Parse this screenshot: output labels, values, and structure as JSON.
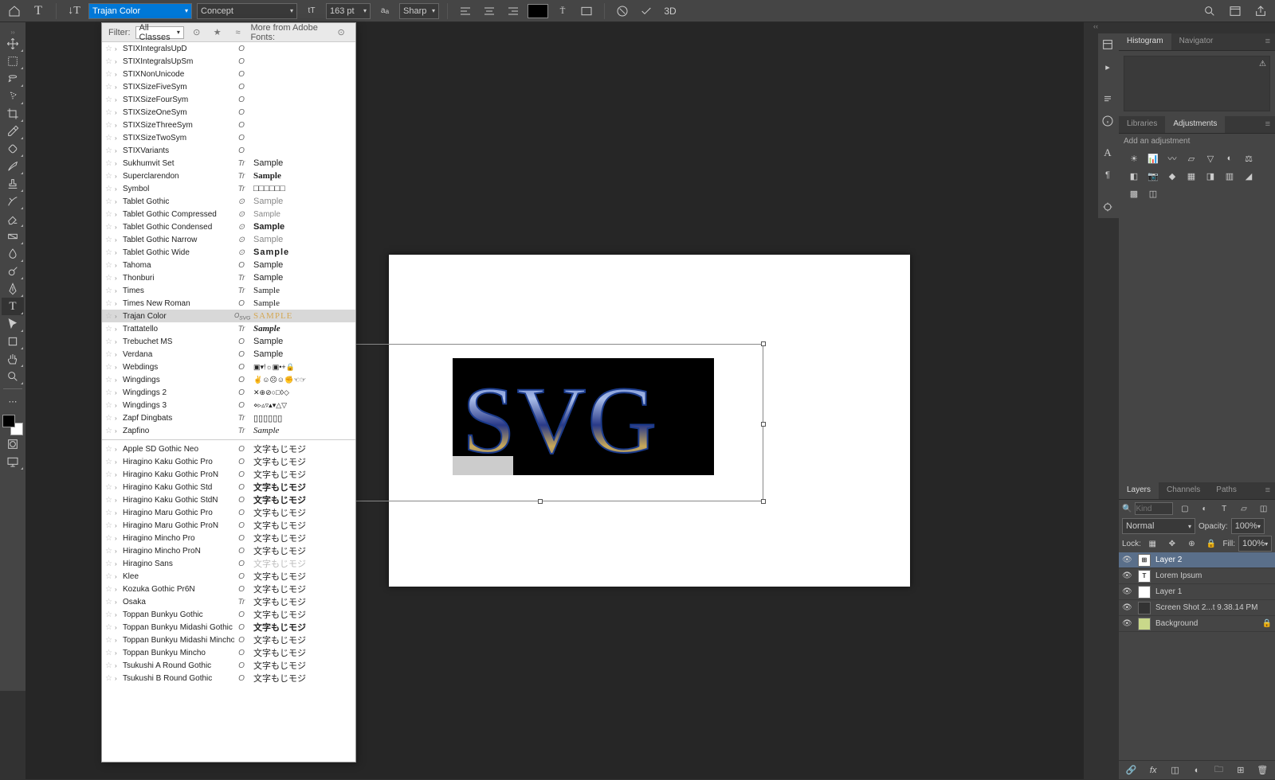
{
  "topbar": {
    "font_family_input": "Trajan Color",
    "font_style": "Concept",
    "font_size": "163 pt",
    "anti_alias": "Sharp",
    "color_swatch": "#000000"
  },
  "font_panel": {
    "filter_label": "Filter:",
    "filter_value": "All Classes",
    "more_fonts_label": "More from Adobe Fonts:",
    "selected": "Trajan Color",
    "groups": [
      [
        {
          "name": "STIXIntegralsUpD",
          "type": "O",
          "sample": ""
        },
        {
          "name": "STIXIntegralsUpSm",
          "type": "O",
          "sample": ""
        },
        {
          "name": "STIXNonUnicode",
          "type": "O",
          "sample": ""
        },
        {
          "name": "STIXSizeFiveSym",
          "type": "O",
          "sample": ""
        },
        {
          "name": "STIXSizeFourSym",
          "type": "O",
          "sample": ""
        },
        {
          "name": "STIXSizeOneSym",
          "type": "O",
          "sample": ""
        },
        {
          "name": "STIXSizeThreeSym",
          "type": "O",
          "sample": ""
        },
        {
          "name": "STIXSizeTwoSym",
          "type": "O",
          "sample": ""
        },
        {
          "name": "STIXVariants",
          "type": "O",
          "sample": ""
        },
        {
          "name": "Sukhumvit Set",
          "type": "Tr",
          "sample": "Sample",
          "sfont": "sans-serif",
          "sstyle": ""
        },
        {
          "name": "Superclarendon",
          "type": "Tr",
          "sample": "Sample",
          "sfont": "Georgia,serif",
          "sstyle": "font-weight:bold;"
        },
        {
          "name": "Symbol",
          "type": "Tr",
          "sample": "□□□□□□",
          "sfont": "serif"
        },
        {
          "name": "Tablet Gothic",
          "type": "⊙",
          "sample": "Sample",
          "sfont": "sans-serif",
          "sstyle": "color:#888;"
        },
        {
          "name": "Tablet Gothic Compressed",
          "type": "⊙",
          "sample": "Sample",
          "sfont": "'Arial Narrow',sans-serif",
          "sstyle": "font-size:10px;color:#888;"
        },
        {
          "name": "Tablet Gothic Condensed",
          "type": "⊙",
          "sample": "Sample",
          "sfont": "sans-serif",
          "sstyle": "font-weight:bold;"
        },
        {
          "name": "Tablet Gothic Narrow",
          "type": "⊙",
          "sample": "Sample",
          "sfont": "'Arial Narrow',sans-serif",
          "sstyle": "color:#888;"
        },
        {
          "name": "Tablet Gothic Wide",
          "type": "⊙",
          "sample": "Sample",
          "sfont": "sans-serif",
          "sstyle": "font-weight:900;letter-spacing:1px;"
        },
        {
          "name": "Tahoma",
          "type": "O",
          "sample": "Sample",
          "sfont": "Tahoma,sans-serif"
        },
        {
          "name": "Thonburi",
          "type": "Tr",
          "sample": "Sample",
          "sfont": "sans-serif"
        },
        {
          "name": "Times",
          "type": "Tr",
          "sample": "Sample",
          "sfont": "Times,serif"
        },
        {
          "name": "Times New Roman",
          "type": "O",
          "sample": "Sample",
          "sfont": "'Times New Roman',serif"
        },
        {
          "name": "Trajan Color",
          "type": "O_svg",
          "sample": "SAMPLE",
          "sfont": "'Trajan Pro','Times New Roman',serif",
          "sstyle": "color:#d4a855;letter-spacing:1px;"
        },
        {
          "name": "Trattatello",
          "type": "Tr",
          "sample": "Sample",
          "sfont": "cursive",
          "sstyle": "font-style:italic;font-weight:bold;"
        },
        {
          "name": "Trebuchet MS",
          "type": "O",
          "sample": "Sample",
          "sfont": "'Trebuchet MS',sans-serif"
        },
        {
          "name": "Verdana",
          "type": "O",
          "sample": "Sample",
          "sfont": "Verdana,sans-serif"
        },
        {
          "name": "Webdings",
          "type": "O",
          "sample": "▣▾!☼▣•+🔒",
          "sfont": "sans-serif",
          "sstyle": "font-size:9px;"
        },
        {
          "name": "Wingdings",
          "type": "O",
          "sample": "✌☺☹☺✊☜☞",
          "sfont": "sans-serif",
          "sstyle": "font-size:9px;"
        },
        {
          "name": "Wingdings 2",
          "type": "O",
          "sample": "✕⊕⊘○□◊◇",
          "sfont": "sans-serif",
          "sstyle": "font-size:9px;"
        },
        {
          "name": "Wingdings 3",
          "type": "O",
          "sample": "⋄▹▵▿▴▾△▽",
          "sfont": "sans-serif",
          "sstyle": "font-size:9px;"
        },
        {
          "name": "Zapf Dingbats",
          "type": "Tr",
          "sample": "▯▯▯▯▯▯",
          "sfont": "serif"
        },
        {
          "name": "Zapfino",
          "type": "Tr",
          "sample": "Sample",
          "sfont": "cursive",
          "sstyle": "font-style:italic;"
        }
      ],
      [
        {
          "name": "Apple SD Gothic Neo",
          "type": "O",
          "sample": "文字もじモジ",
          "sfont": "sans-serif"
        },
        {
          "name": "Hiragino Kaku Gothic Pro",
          "type": "O",
          "sample": "文字もじモジ",
          "sfont": "sans-serif"
        },
        {
          "name": "Hiragino Kaku Gothic ProN",
          "type": "O",
          "sample": "文字もじモジ",
          "sfont": "sans-serif"
        },
        {
          "name": "Hiragino Kaku Gothic Std",
          "type": "O",
          "sample": "文字もじモジ",
          "sfont": "sans-serif",
          "sstyle": "font-weight:bold;"
        },
        {
          "name": "Hiragino Kaku Gothic StdN",
          "type": "O",
          "sample": "文字もじモジ",
          "sfont": "sans-serif",
          "sstyle": "font-weight:bold;"
        },
        {
          "name": "Hiragino Maru Gothic Pro",
          "type": "O",
          "sample": "文字もじモジ",
          "sfont": "sans-serif"
        },
        {
          "name": "Hiragino Maru Gothic ProN",
          "type": "O",
          "sample": "文字もじモジ",
          "sfont": "sans-serif"
        },
        {
          "name": "Hiragino Mincho Pro",
          "type": "O",
          "sample": "文字もじモジ",
          "sfont": "serif"
        },
        {
          "name": "Hiragino Mincho ProN",
          "type": "O",
          "sample": "文字もじモジ",
          "sfont": "serif"
        },
        {
          "name": "Hiragino Sans",
          "type": "O",
          "sample": "文字もじモジ",
          "sfont": "sans-serif",
          "sstyle": "color:#bbb;"
        },
        {
          "name": "Klee",
          "type": "O",
          "sample": "文字もじモジ",
          "sfont": "serif"
        },
        {
          "name": "Kozuka Gothic Pr6N",
          "type": "O",
          "sample": "文字もじモジ",
          "sfont": "sans-serif"
        },
        {
          "name": "Osaka",
          "type": "Tr",
          "sample": "文字もじモジ",
          "sfont": "sans-serif"
        },
        {
          "name": "Toppan Bunkyu Gothic",
          "type": "O",
          "sample": "文字もじモジ",
          "sfont": "sans-serif"
        },
        {
          "name": "Toppan Bunkyu Midashi Gothic",
          "type": "O",
          "sample": "文字もじモジ",
          "sfont": "sans-serif",
          "sstyle": "font-weight:bold;"
        },
        {
          "name": "Toppan Bunkyu Midashi Mincho",
          "type": "O",
          "sample": "文字もじモジ",
          "sfont": "serif"
        },
        {
          "name": "Toppan Bunkyu Mincho",
          "type": "O",
          "sample": "文字もじモジ",
          "sfont": "serif"
        },
        {
          "name": "Tsukushi A Round Gothic",
          "type": "O",
          "sample": "文字もじモジ",
          "sfont": "sans-serif"
        },
        {
          "name": "Tsukushi B Round Gothic",
          "type": "O",
          "sample": "文字もじモジ",
          "sfont": "sans-serif"
        }
      ]
    ]
  },
  "canvas": {
    "text_content": "SVG"
  },
  "right": {
    "panel1_tabs": [
      "Histogram",
      "Navigator"
    ],
    "panel2_tabs": [
      "Libraries",
      "Adjustments"
    ],
    "adjustments_label": "Add an adjustment",
    "panel3_tabs": [
      "Layers",
      "Channels",
      "Paths"
    ],
    "layer_search_placeholder": "Kind",
    "blend_mode": "Normal",
    "opacity_label": "Opacity:",
    "opacity_value": "100%",
    "lock_label": "Lock:",
    "fill_label": "Fill:",
    "fill_value": "100%",
    "layers": [
      {
        "name": "Layer 2",
        "thumb": "⊞",
        "selected": true
      },
      {
        "name": "Lorem Ipsum",
        "thumb": "T",
        "selected": false
      },
      {
        "name": "Layer 1",
        "thumb": "",
        "selected": false,
        "thumb_bg": "#fff"
      },
      {
        "name": "Screen Shot 2...t 9.38.14 PM",
        "thumb": "",
        "selected": false,
        "thumb_bg": "#333"
      },
      {
        "name": "Background",
        "thumb": "",
        "selected": false,
        "thumb_bg": "#c9d88a",
        "locked": true
      }
    ]
  }
}
